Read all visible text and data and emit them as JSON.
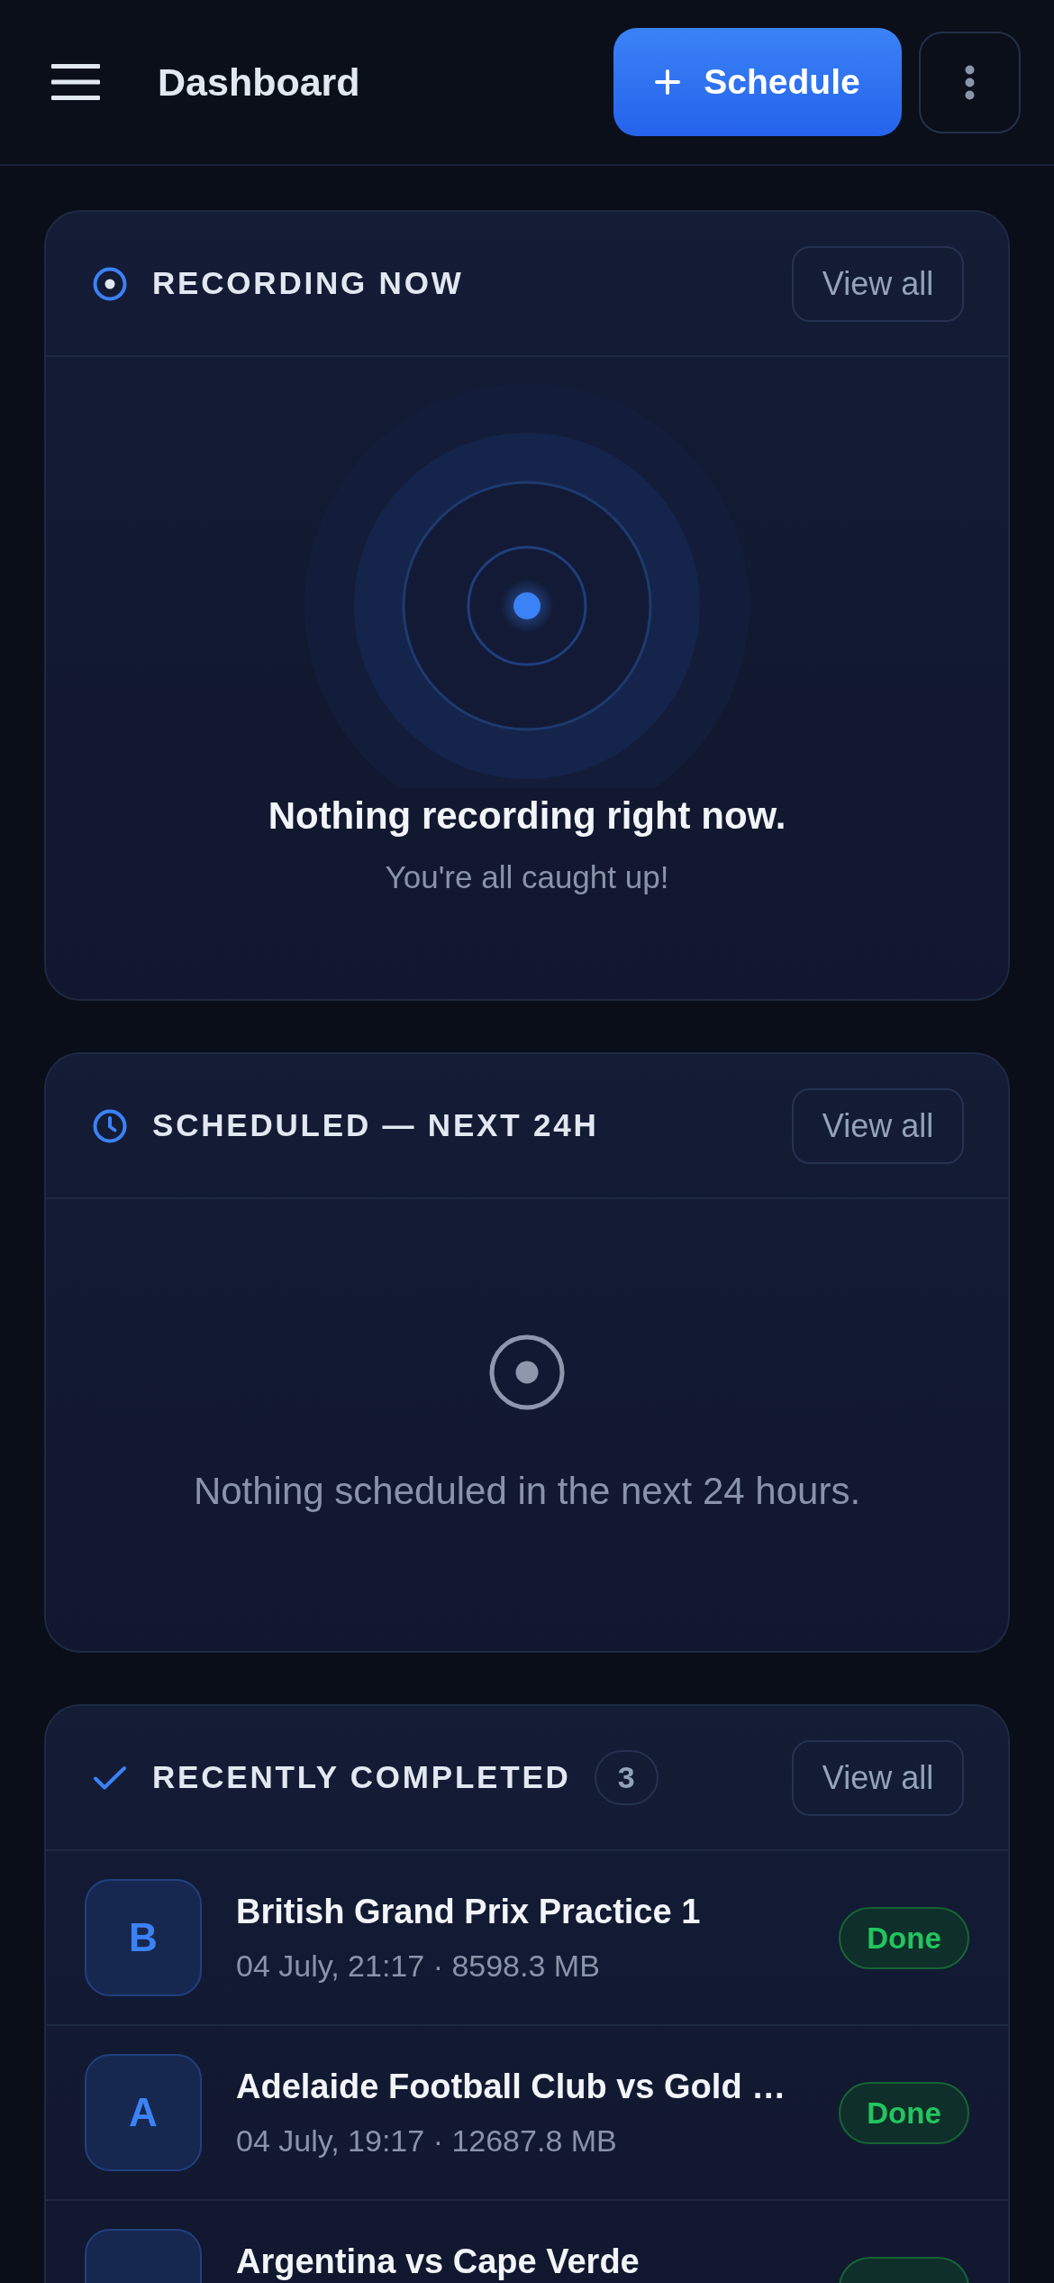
{
  "header": {
    "title": "Dashboard",
    "action": {
      "label": "Schedule"
    }
  },
  "sections": [
    {
      "kind": "recording",
      "title": "RECORDING NOW",
      "action": "View all",
      "empty": {
        "title": "Nothing recording right now.",
        "subtitle": "You're all caught up!"
      }
    },
    {
      "kind": "scheduled",
      "title": "SCHEDULED — NEXT 24H",
      "action": "View all",
      "empty": {
        "message": "Nothing scheduled in the next 24 hours."
      }
    },
    {
      "kind": "completed",
      "title": "RECENTLY COMPLETED",
      "count": "3",
      "action": "View all",
      "items": [
        {
          "initial": "B",
          "title": "British Grand Prix Practice 1",
          "meta": "04 July, 21:17 · 8598.3 MB",
          "done": true,
          "status_label": "Done"
        },
        {
          "initial": "A",
          "title": "Adelaide Football Club vs Gold …",
          "meta": "04 July, 19:17 · 12687.8 MB",
          "done": true,
          "status_label": "Done"
        },
        {
          "title": "Argentina vs Cape Verde",
          "done": true
        }
      ]
    }
  ]
}
